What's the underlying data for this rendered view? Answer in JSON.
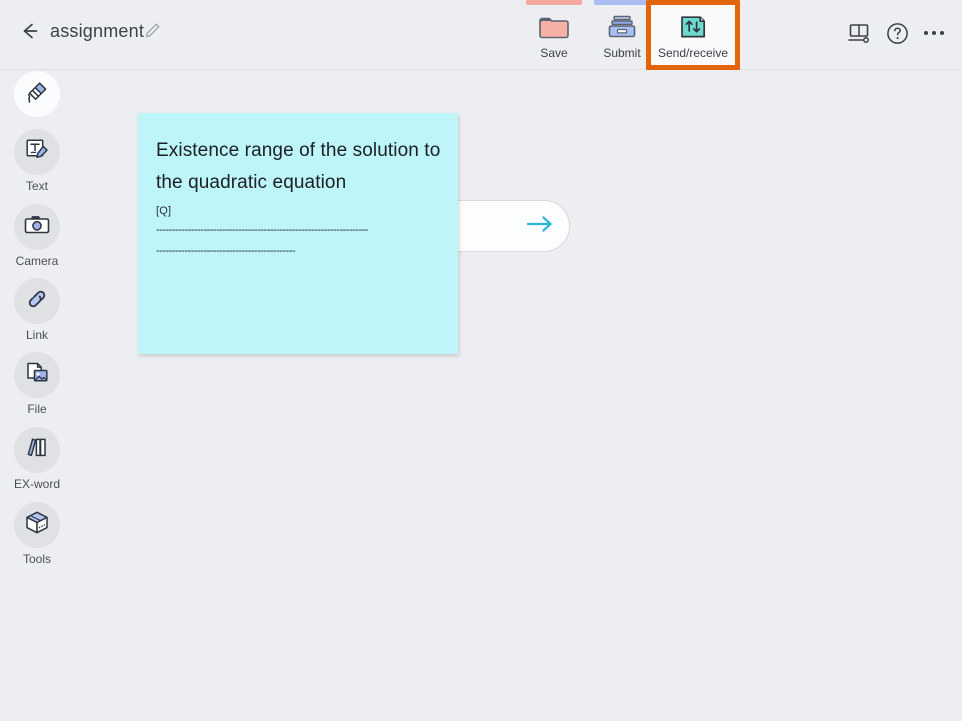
{
  "header": {
    "back_icon": "back-arrow-icon",
    "title": "assignment",
    "edit_icon": "pencil-edit-icon",
    "toolbar": [
      {
        "label": "Save",
        "icon": "folder-icon",
        "accent": "#f5a9a0",
        "highlighted": false
      },
      {
        "label": "Submit",
        "icon": "inbox-tray-icon",
        "accent": "#a9bdf2",
        "highlighted": false
      },
      {
        "label": "Send/receive",
        "icon": "send-receive-icon",
        "accent": "#9fe8e0",
        "highlighted": true
      }
    ],
    "right_icons": [
      {
        "name": "presentation-display-icon"
      },
      {
        "name": "help-question-icon"
      },
      {
        "name": "more-options-icon"
      }
    ],
    "highlight_color": "#e3650b"
  },
  "sidebar": {
    "items": [
      {
        "label": "",
        "icon": "pen-highlighter-icon",
        "active": true
      },
      {
        "label": "Text",
        "icon": "text-edit-icon",
        "active": false
      },
      {
        "label": "Camera",
        "icon": "camera-icon",
        "active": false
      },
      {
        "label": "Link",
        "icon": "link-chain-icon",
        "active": false
      },
      {
        "label": "File",
        "icon": "file-image-icon",
        "active": false
      },
      {
        "label": "EX-word",
        "icon": "books-icon",
        "active": false
      },
      {
        "label": "Tools",
        "icon": "toolbox-cube-icon",
        "active": false
      }
    ]
  },
  "canvas": {
    "next_button": {
      "icon": "arrow-right-icon",
      "color": "#29b6d8"
    },
    "note": {
      "background": "#bdf5f8",
      "title": "Existence range of the solution to the quadratic equation",
      "tag": "[Q]",
      "rule_line_1": "-------------------------------------------------------------------",
      "rule_line_2": "--------------------------------------------"
    }
  }
}
